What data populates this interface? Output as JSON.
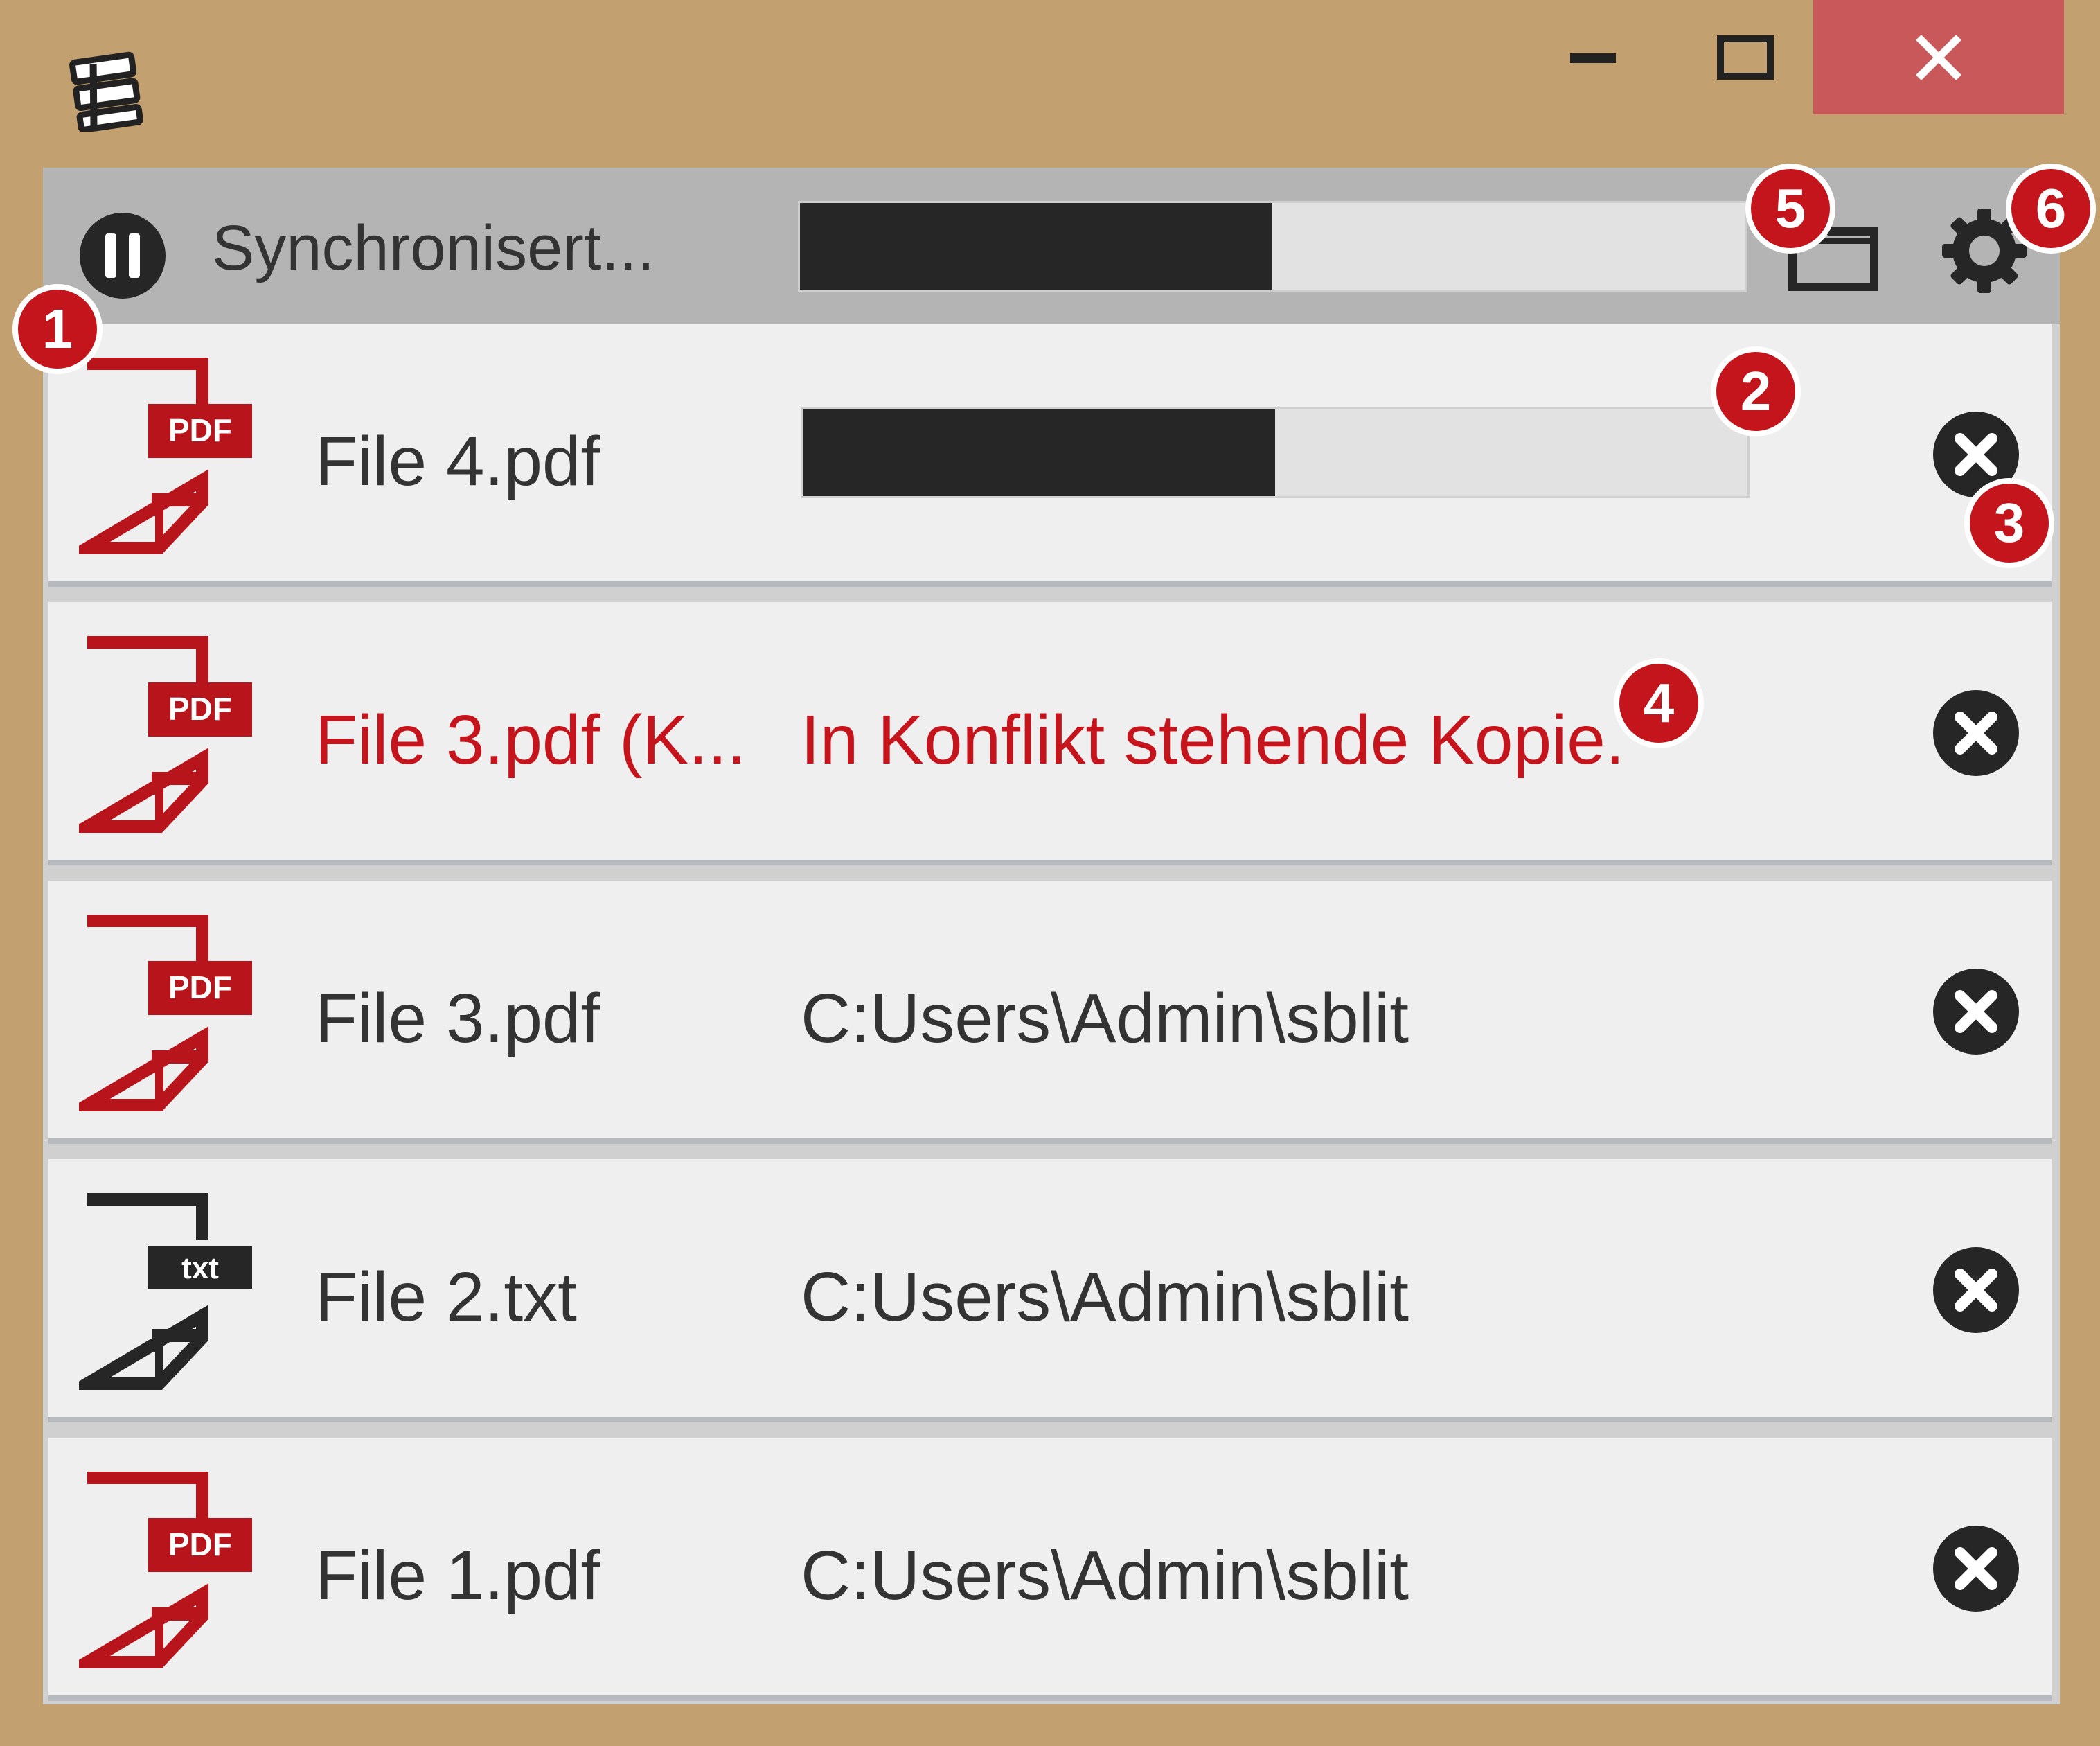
{
  "window": {
    "accent": "#c3a070",
    "close_color": "#c9585a",
    "min_icon": "minimize-icon",
    "max_icon": "maximize-icon",
    "close_icon": "close-icon"
  },
  "toolbar": {
    "status": "Synchronisert...",
    "progress": 0.5
  },
  "files": [
    {
      "name": "File 4.pdf",
      "type": "PDF",
      "progress": 0.5
    },
    {
      "name": "File 3.pdf (K...",
      "type": "PDF",
      "detail": "In Konflikt stehende Kopie."
    },
    {
      "name": "File 3.pdf",
      "type": "PDF",
      "detail": "C:Users\\Admin\\sblit"
    },
    {
      "name": "File 2.txt",
      "type": "txt",
      "detail": "C:Users\\Admin\\sblit"
    },
    {
      "name": "File 1.pdf",
      "type": "PDF",
      "detail": "C:Users\\Admin\\sblit"
    }
  ],
  "markers": [
    "1",
    "2",
    "3",
    "4",
    "5",
    "6"
  ],
  "colors": {
    "pdf_red": "#b8141b",
    "conflict_red": "#c6141d",
    "marker_red": "#c4151c"
  }
}
